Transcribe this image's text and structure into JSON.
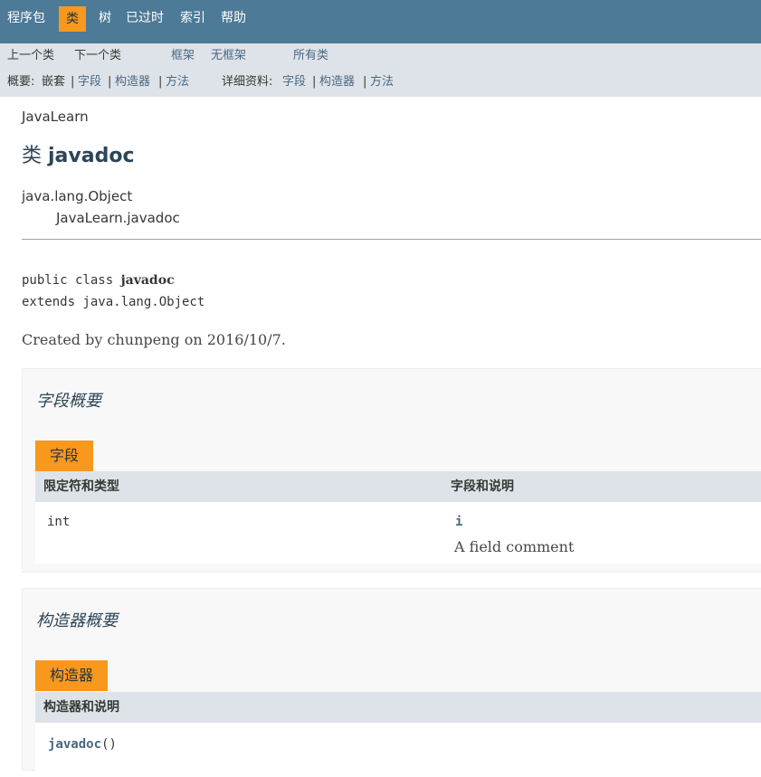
{
  "top_nav": {
    "items": [
      "程序包",
      "类",
      "树",
      "已过时",
      "索引",
      "帮助"
    ],
    "active_index": 1
  },
  "sub_nav": {
    "prev_class": "上一个类",
    "next_class": "下一个类",
    "frames": "框架",
    "no_frames": "无框架",
    "all_classes": "所有类",
    "summary_label": "概要:",
    "summary_nested": "嵌套",
    "summary_field": "字段",
    "summary_constructor": "构造器",
    "summary_method": "方法",
    "detail_label": "详细资料:",
    "detail_field": "字段",
    "detail_constructor": "构造器",
    "detail_method": "方法",
    "sep": "|"
  },
  "header": {
    "package": "JavaLearn",
    "title_prefix": "类",
    "class_name": "javadoc"
  },
  "inheritance": {
    "parent": "java.lang.Object",
    "child": "JavaLearn.javadoc"
  },
  "signature": {
    "modifiers": "public class",
    "name": "javadoc",
    "extends": "extends java.lang.Object"
  },
  "description": "Created by chunpeng on 2016/10/7.",
  "field_summary": {
    "heading": "字段概要",
    "tab": "字段",
    "columns": [
      "限定符和类型",
      "字段和说明"
    ],
    "rows": [
      {
        "type": "int",
        "name": "i",
        "comment": "A field comment"
      }
    ]
  },
  "constructor_summary": {
    "heading": "构造器概要",
    "tab": "构造器",
    "columns": [
      "构造器和说明"
    ],
    "rows": [
      {
        "name": "javadoc",
        "params": "()"
      }
    ]
  },
  "colors": {
    "nav_bg": "#4d7a97",
    "subnav_bg": "#dee3e9",
    "accent": "#f8981d",
    "link": "#4a6782"
  }
}
